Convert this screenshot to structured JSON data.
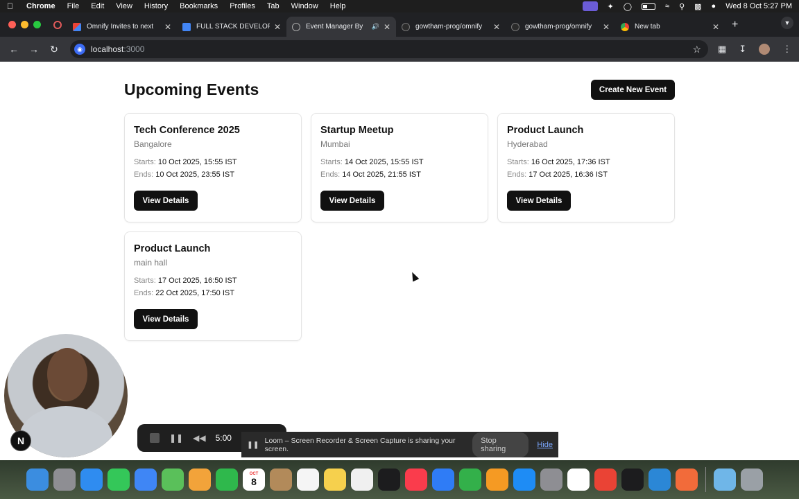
{
  "menubar": {
    "app_name": "Chrome",
    "items": [
      "File",
      "Edit",
      "View",
      "History",
      "Bookmarks",
      "Profiles",
      "Tab",
      "Window",
      "Help"
    ],
    "clock": "Wed 8 Oct  5:27 PM"
  },
  "tabs": [
    {
      "label": "Omnify Invites to next",
      "icon": "gmail-icon",
      "active": false
    },
    {
      "label": "FULL STACK DEVELOPER",
      "icon": "docs-icon",
      "active": false
    },
    {
      "label": "Event Manager By",
      "icon": "globe-icon",
      "active": true,
      "audio": true
    },
    {
      "label": "gowtham-prog/omnify",
      "icon": "github-icon",
      "active": false
    },
    {
      "label": "gowtham-prog/omnify",
      "icon": "github-icon",
      "active": false
    },
    {
      "label": "New tab",
      "icon": "chrome-icon",
      "active": false
    }
  ],
  "address_bar": {
    "host": "localhost",
    "port": ":3000"
  },
  "page": {
    "title": "Upcoming Events",
    "create_button": "Create New Event",
    "starts_label": "Starts:",
    "ends_label": "Ends:",
    "view_details_label": "View Details",
    "events": [
      {
        "title": "Tech Conference 2025",
        "location": "Bangalore",
        "starts": "10 Oct 2025, 15:55 IST",
        "ends": "10 Oct 2025, 23:55 IST"
      },
      {
        "title": "Startup Meetup",
        "location": "Mumbai",
        "starts": "14 Oct 2025, 15:55 IST",
        "ends": "14 Oct 2025, 21:55 IST"
      },
      {
        "title": "Product Launch",
        "location": "Hyderabad",
        "starts": "16 Oct 2025, 17:36 IST",
        "ends": "17 Oct 2025, 16:36 IST"
      },
      {
        "title": "Product Launch",
        "location": "main hall",
        "starts": "17 Oct 2025, 16:50 IST",
        "ends": "22 Oct 2025, 17:50 IST"
      }
    ]
  },
  "loom": {
    "timer": "5:00",
    "share_message": "Loom – Screen Recorder & Screen Capture is sharing your screen.",
    "stop_sharing": "Stop sharing",
    "hide": "Hide"
  },
  "badge": {
    "letter": "N"
  },
  "dock": {
    "calendar_month": "OCT",
    "calendar_day": "8",
    "apps": [
      {
        "name": "finder",
        "color": "#3b8de0"
      },
      {
        "name": "launchpad",
        "color": "#8e8e93"
      },
      {
        "name": "safari",
        "color": "#2f8cf0"
      },
      {
        "name": "messages",
        "color": "#34c759"
      },
      {
        "name": "mail",
        "color": "#3f86f5"
      },
      {
        "name": "maps",
        "color": "#5ac05a"
      },
      {
        "name": "photos",
        "color": "#f2a33a"
      },
      {
        "name": "facetime",
        "color": "#2fb84c"
      },
      {
        "name": "calendar",
        "color": "#ffffff"
      },
      {
        "name": "contacts",
        "color": "#b28a5a"
      },
      {
        "name": "reminders",
        "color": "#f5f5f5"
      },
      {
        "name": "notes",
        "color": "#f6d04d"
      },
      {
        "name": "freeform",
        "color": "#f0f0f0"
      },
      {
        "name": "tv",
        "color": "#1c1c1e"
      },
      {
        "name": "music",
        "color": "#fa3c4c"
      },
      {
        "name": "keynote",
        "color": "#2f7cf6"
      },
      {
        "name": "numbers",
        "color": "#33b04a"
      },
      {
        "name": "pages",
        "color": "#f59a23"
      },
      {
        "name": "app-store",
        "color": "#1e8cf5"
      },
      {
        "name": "system-settings",
        "color": "#8e8e93"
      },
      {
        "name": "notion",
        "color": "#ffffff"
      },
      {
        "name": "chrome",
        "color": "#ea4335"
      },
      {
        "name": "terminal",
        "color": "#1c1c1e"
      },
      {
        "name": "vscode",
        "color": "#2b87d6"
      },
      {
        "name": "postman",
        "color": "#f26b3a"
      }
    ]
  }
}
